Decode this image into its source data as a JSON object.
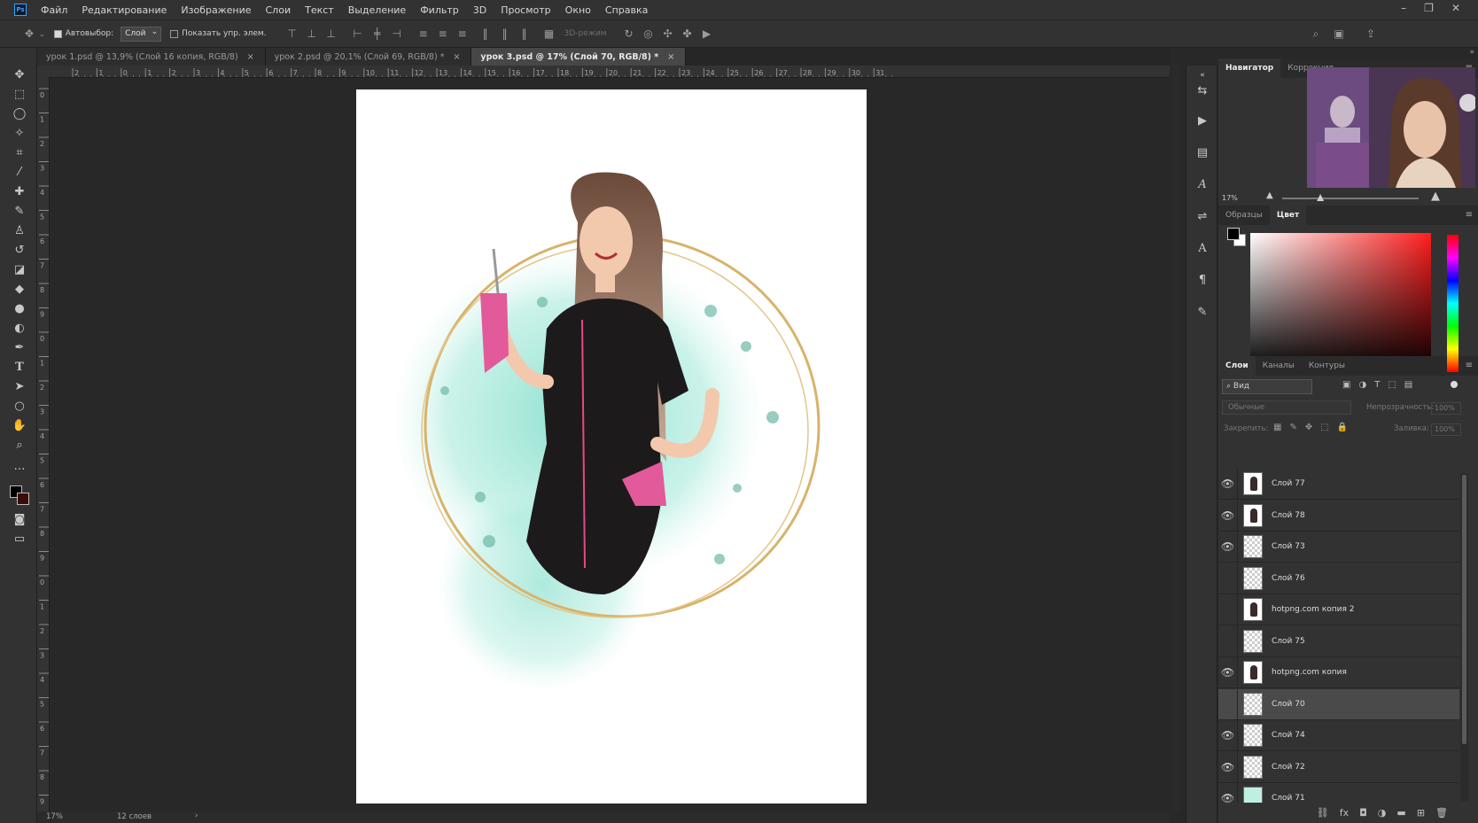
{
  "menubar": {
    "logo": "Ps",
    "items": [
      "Файл",
      "Редактирование",
      "Изображение",
      "Слои",
      "Текст",
      "Выделение",
      "Фильтр",
      "3D",
      "Просмотр",
      "Окно",
      "Справка"
    ]
  },
  "options": {
    "autoselect_label": "Автовыбор:",
    "autoselect_value": "Слой",
    "show_transform_label": "Показать упр. элем.",
    "mode3d_label": "3D-режим"
  },
  "tabs": [
    {
      "label": "урок 1.psd @ 13,9% (Слой 16 копия, RGB/8)"
    },
    {
      "label": "урок 2.psd @ 20,1% (Слой 69, RGB/8) *"
    },
    {
      "label": "урок 3.psd @ 17% (Слой 70, RGB/8) *"
    }
  ],
  "tab_close": "×",
  "ruler": {
    "top": [
      "2",
      "1",
      "0",
      "1",
      "2",
      "3",
      "4",
      "5",
      "6",
      "7",
      "8",
      "9",
      "10",
      "11",
      "12",
      "13",
      "14",
      "15",
      "16",
      "17",
      "18",
      "19",
      "20",
      "21",
      "22",
      "23",
      "24",
      "25",
      "26",
      "27",
      "28",
      "29",
      "30",
      "31"
    ],
    "left": [
      "0",
      "1",
      "2",
      "3",
      "4",
      "5",
      "6",
      "7",
      "8",
      "9",
      "0",
      "1",
      "2",
      "3",
      "4",
      "5",
      "6",
      "7",
      "8",
      "9",
      "0",
      "1",
      "2",
      "3",
      "4",
      "5",
      "6",
      "7",
      "8",
      "9"
    ]
  },
  "status": {
    "zoom": "17%",
    "info": "12 слоев"
  },
  "navigator": {
    "tab_active": "Навигатор",
    "tab_other": "Коррекция",
    "zoom": "17%",
    "zoom_level": 0.28
  },
  "color": {
    "tab_swatches": "Образцы",
    "tab_color": "Цвет",
    "fg": "#000000",
    "bg": "#ffffff",
    "hue": "#ff0000"
  },
  "layers": {
    "tabs": [
      "Слои",
      "Каналы",
      "Контуры"
    ],
    "filter_label": "Вид",
    "blend_mode": "Обычные",
    "opacity_label": "Непрозрачность:",
    "opacity_value": "100%",
    "lock_label": "Закрепить:",
    "fill_label": "Заливка:",
    "fill_value": "100%",
    "items": [
      {
        "name": "Слой 77",
        "visible": true,
        "thumb": "fig"
      },
      {
        "name": "Слой 78",
        "visible": true,
        "thumb": "fig"
      },
      {
        "name": "Слой 73",
        "visible": true,
        "thumb": "empty"
      },
      {
        "name": "Слой 76",
        "visible": false,
        "thumb": "empty"
      },
      {
        "name": "hotpng.com копия 2",
        "visible": false,
        "thumb": "fig"
      },
      {
        "name": "Слой 75",
        "visible": false,
        "thumb": "empty"
      },
      {
        "name": "hotpng.com копия",
        "visible": true,
        "thumb": "fig"
      },
      {
        "name": "Слой 70",
        "visible": false,
        "thumb": "empty",
        "selected": true
      },
      {
        "name": "Слой 74",
        "visible": true,
        "thumb": "empty"
      },
      {
        "name": "Слой 72",
        "visible": true,
        "thumb": "empty"
      },
      {
        "name": "Слой 71",
        "visible": true,
        "thumb": "teal"
      }
    ]
  }
}
